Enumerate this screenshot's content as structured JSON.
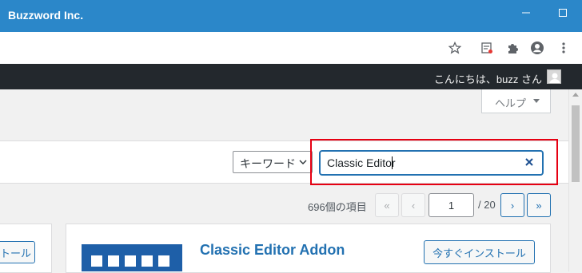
{
  "window": {
    "title": "Buzzword Inc."
  },
  "admin_bar": {
    "greeting": "こんにちは、buzz さん"
  },
  "help": {
    "label": "ヘルプ"
  },
  "search": {
    "type_selected": "キーワード",
    "query": "Classic Editor"
  },
  "pagination": {
    "count": "696個の項目",
    "first": "«",
    "prev": "‹",
    "current_page": "1",
    "total": "/ 20",
    "next": "›",
    "last": "»"
  },
  "plugins": [
    {
      "install_label": "今すぐインストール"
    },
    {
      "name": "Classic Editor Addon",
      "install_label": "今すぐインストール"
    }
  ],
  "colors": {
    "accent": "#2271b1",
    "titlebar": "#2b87c9",
    "admin_bar": "#23282d",
    "highlight": "#e60012"
  }
}
